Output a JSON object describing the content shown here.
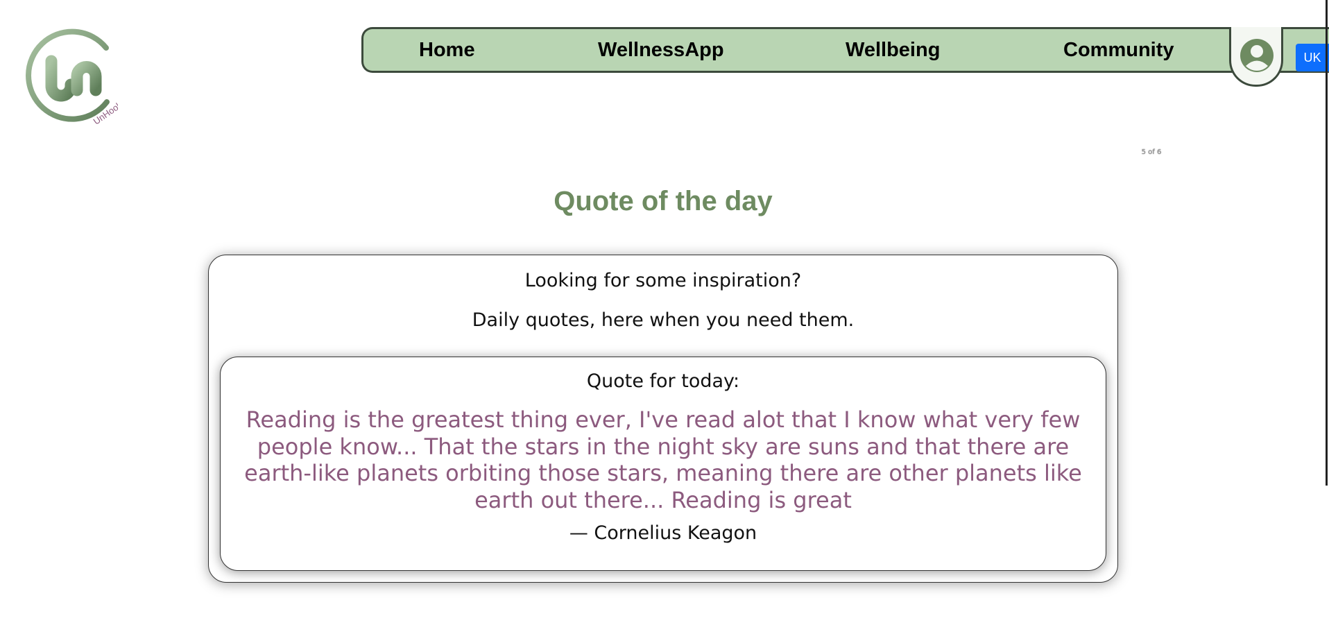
{
  "brand": {
    "logo_text": "UnHook"
  },
  "nav": {
    "items": [
      {
        "label": "Home"
      },
      {
        "label": "WellnessApp"
      },
      {
        "label": "Wellbeing"
      },
      {
        "label": "Community"
      }
    ],
    "profile_icon": "user-circle-icon",
    "language_label": "UK",
    "bar_color": "#b9d5b3"
  },
  "page_counter": "5 of 6",
  "main": {
    "title": "Quote of the day",
    "intro_line1": "Looking for some inspiration?",
    "intro_line2": "Daily quotes, here when you need them.",
    "quote_label": "Quote for today:",
    "quote_text": "Reading is the greatest thing ever, I've read alot that I know what very few people know... That the stars in the night sky are suns and that there are earth-like planets orbiting those stars, meaning there are other planets like earth out there... Reading is great",
    "quote_author": "— Cornelius Keagon"
  },
  "colors": {
    "title": "#6e8b61",
    "quote": "#8c5a7e",
    "accent_button": "#0d6efd"
  }
}
